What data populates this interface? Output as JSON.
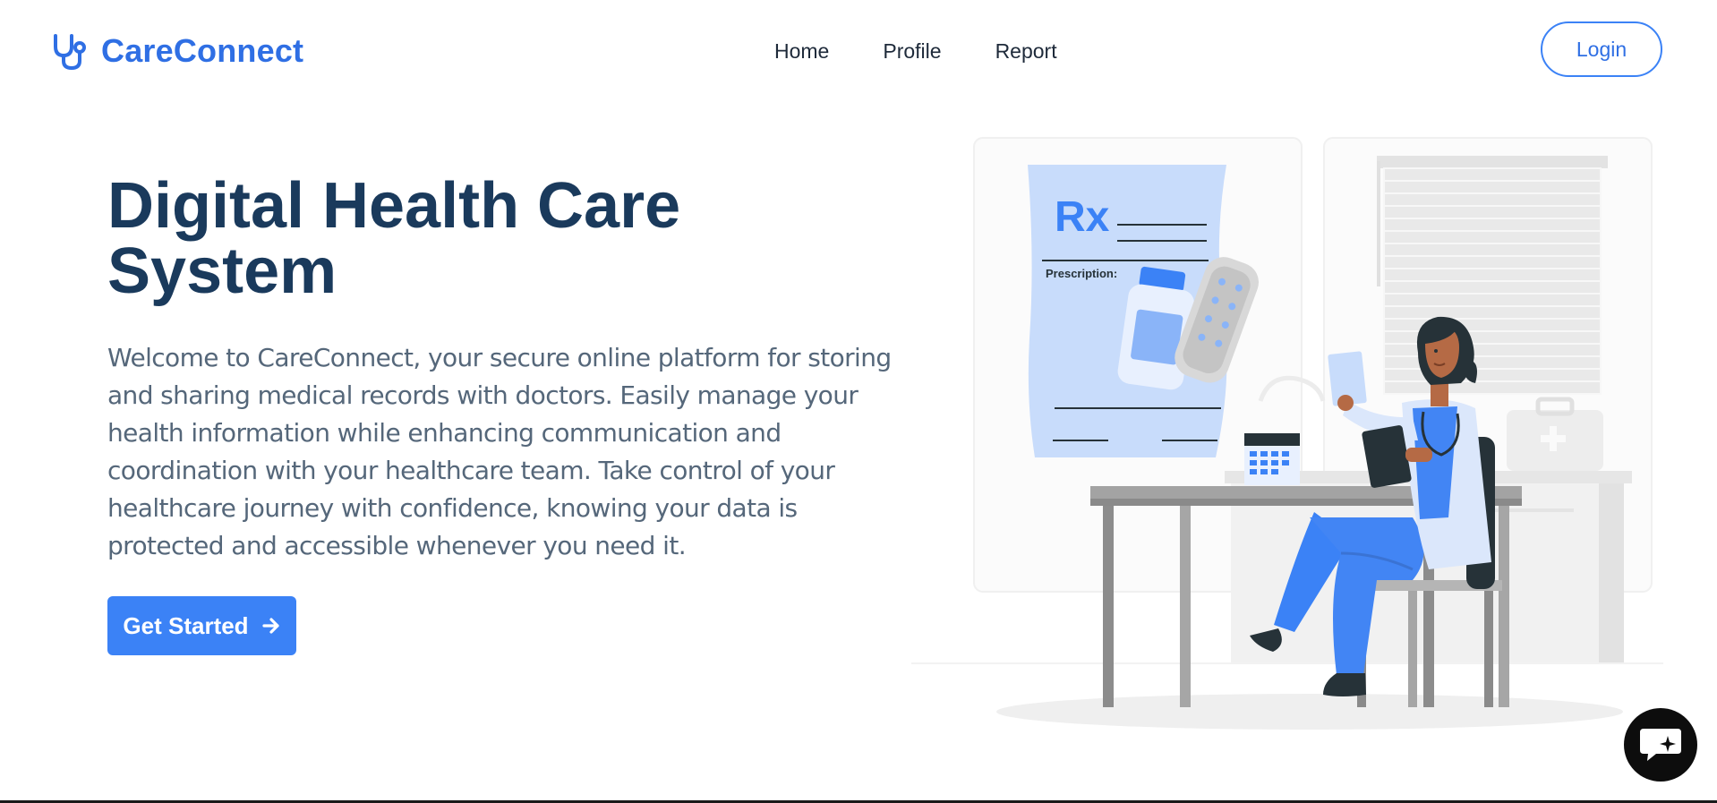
{
  "brand": {
    "name": "CareConnect",
    "icon": "stethoscope-icon",
    "color": "#2f6fe4"
  },
  "nav": {
    "items": [
      {
        "label": "Home"
      },
      {
        "label": "Profile"
      },
      {
        "label": "Report"
      }
    ]
  },
  "login": {
    "label": "Login"
  },
  "hero": {
    "title": "Digital Health Care System",
    "description": "Welcome to CareConnect, your secure online platform for storing and sharing medical records with doctors. Easily manage your health information while enhancing communication and coordination with your healthcare team. Take control of your healthcare journey with confidence, knowing your data is protected and accessible whenever you need it.",
    "cta_label": "Get Started",
    "cta_icon": "arrow-right-icon"
  },
  "illustration": {
    "rx_text": "Rx",
    "prescription_label": "Prescription:"
  },
  "chat": {
    "icon": "chat-sparkle-icon"
  },
  "colors": {
    "accent": "#3b82f6",
    "title": "#1a3a5c",
    "body_text": "#55677a"
  }
}
